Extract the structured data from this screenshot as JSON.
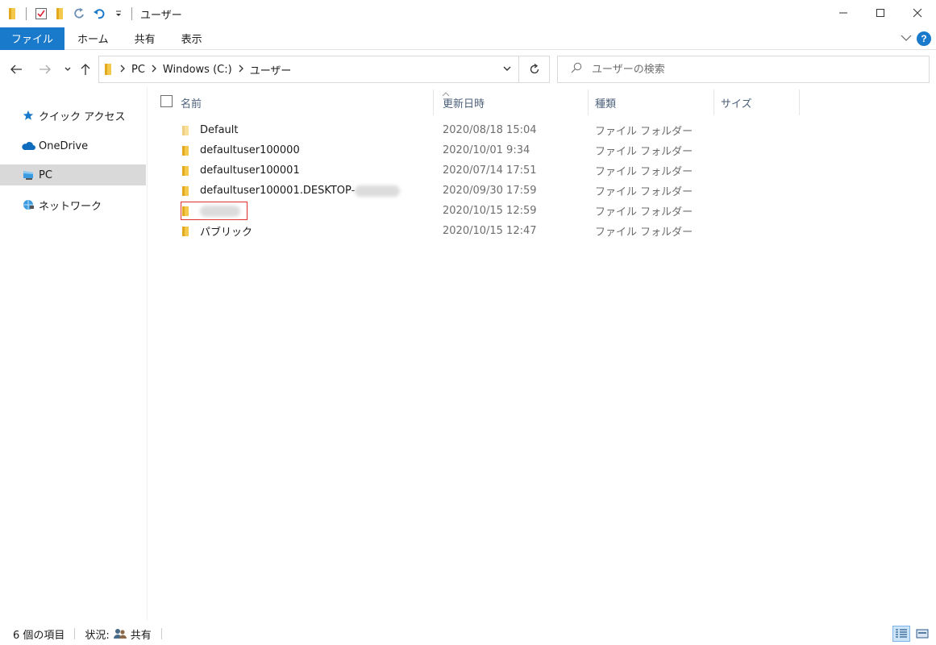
{
  "window": {
    "title": "ユーザー"
  },
  "ribbon": {
    "tabs": [
      {
        "label": "ファイル",
        "active": true
      },
      {
        "label": "ホーム"
      },
      {
        "label": "共有"
      },
      {
        "label": "表示"
      }
    ],
    "help_label": "?"
  },
  "address": {
    "crumbs": [
      "PC",
      "Windows (C:)",
      "ユーザー"
    ],
    "search_placeholder": "ユーザーの検索"
  },
  "navpane": {
    "items": [
      {
        "label": "クイック アクセス",
        "icon": "star-icon"
      },
      {
        "label": "OneDrive",
        "icon": "cloud-icon"
      },
      {
        "label": "PC",
        "icon": "pc-icon",
        "selected": true
      },
      {
        "label": "ネットワーク",
        "icon": "network-icon"
      }
    ]
  },
  "columns": {
    "name": "名前",
    "date": "更新日時",
    "type": "種類",
    "size": "サイズ"
  },
  "files": [
    {
      "name": "Default",
      "date": "2020/08/18 15:04",
      "type": "ファイル フォルダー",
      "faded": true
    },
    {
      "name": "defaultuser100000",
      "date": "2020/10/01 9:34",
      "type": "ファイル フォルダー"
    },
    {
      "name": "defaultuser100001",
      "date": "2020/07/14 17:51",
      "type": "ファイル フォルダー"
    },
    {
      "name": "defaultuser100001.DESKTOP-",
      "date": "2020/09/30 17:59",
      "type": "ファイル フォルダー",
      "blur_suffix": true
    },
    {
      "name": "",
      "date": "2020/10/15 12:59",
      "type": "ファイル フォルダー",
      "blurred_name": true,
      "highlighted": true
    },
    {
      "name": "パブリック",
      "date": "2020/10/15 12:47",
      "type": "ファイル フォルダー"
    }
  ],
  "status": {
    "count": "6 個の項目",
    "state_label": "状況:",
    "state_value": "共有"
  },
  "colors": {
    "accent": "#1979ca",
    "folder": "#f4c84a",
    "highlight": "#e03131"
  }
}
